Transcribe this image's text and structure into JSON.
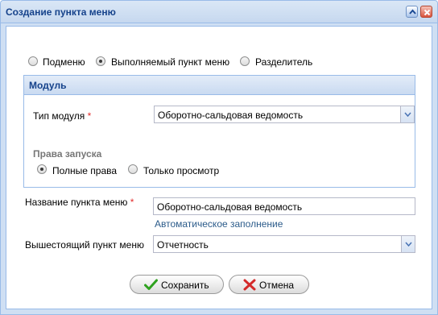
{
  "window": {
    "title": "Создание пункта меню"
  },
  "menu_type": {
    "options": [
      "Подменю",
      "Выполняемый пункт меню",
      "Разделитель"
    ],
    "selected_index": 1
  },
  "module": {
    "title": "Модуль",
    "type_label": "Тип модуля",
    "required_mark": "*",
    "type_value": "Оборотно-сальдовая ведомость",
    "rights_title": "Права запуска",
    "rights_options": [
      "Полные права",
      "Только просмотр"
    ],
    "rights_selected_index": 0
  },
  "name_field": {
    "label": "Название пункта меню",
    "required_mark": "*",
    "value": "Оборотно-сальдовая ведомость",
    "autofill_link": "Автоматическое заполнение"
  },
  "parent_field": {
    "label": "Вышестоящий пункт меню",
    "value": "Отчетность"
  },
  "buttons": {
    "save": "Сохранить",
    "cancel": "Отмена"
  },
  "colors": {
    "title_text": "#15428b",
    "border": "#99bbe8",
    "required": "#e32d2d",
    "link": "#2b5b8a"
  }
}
